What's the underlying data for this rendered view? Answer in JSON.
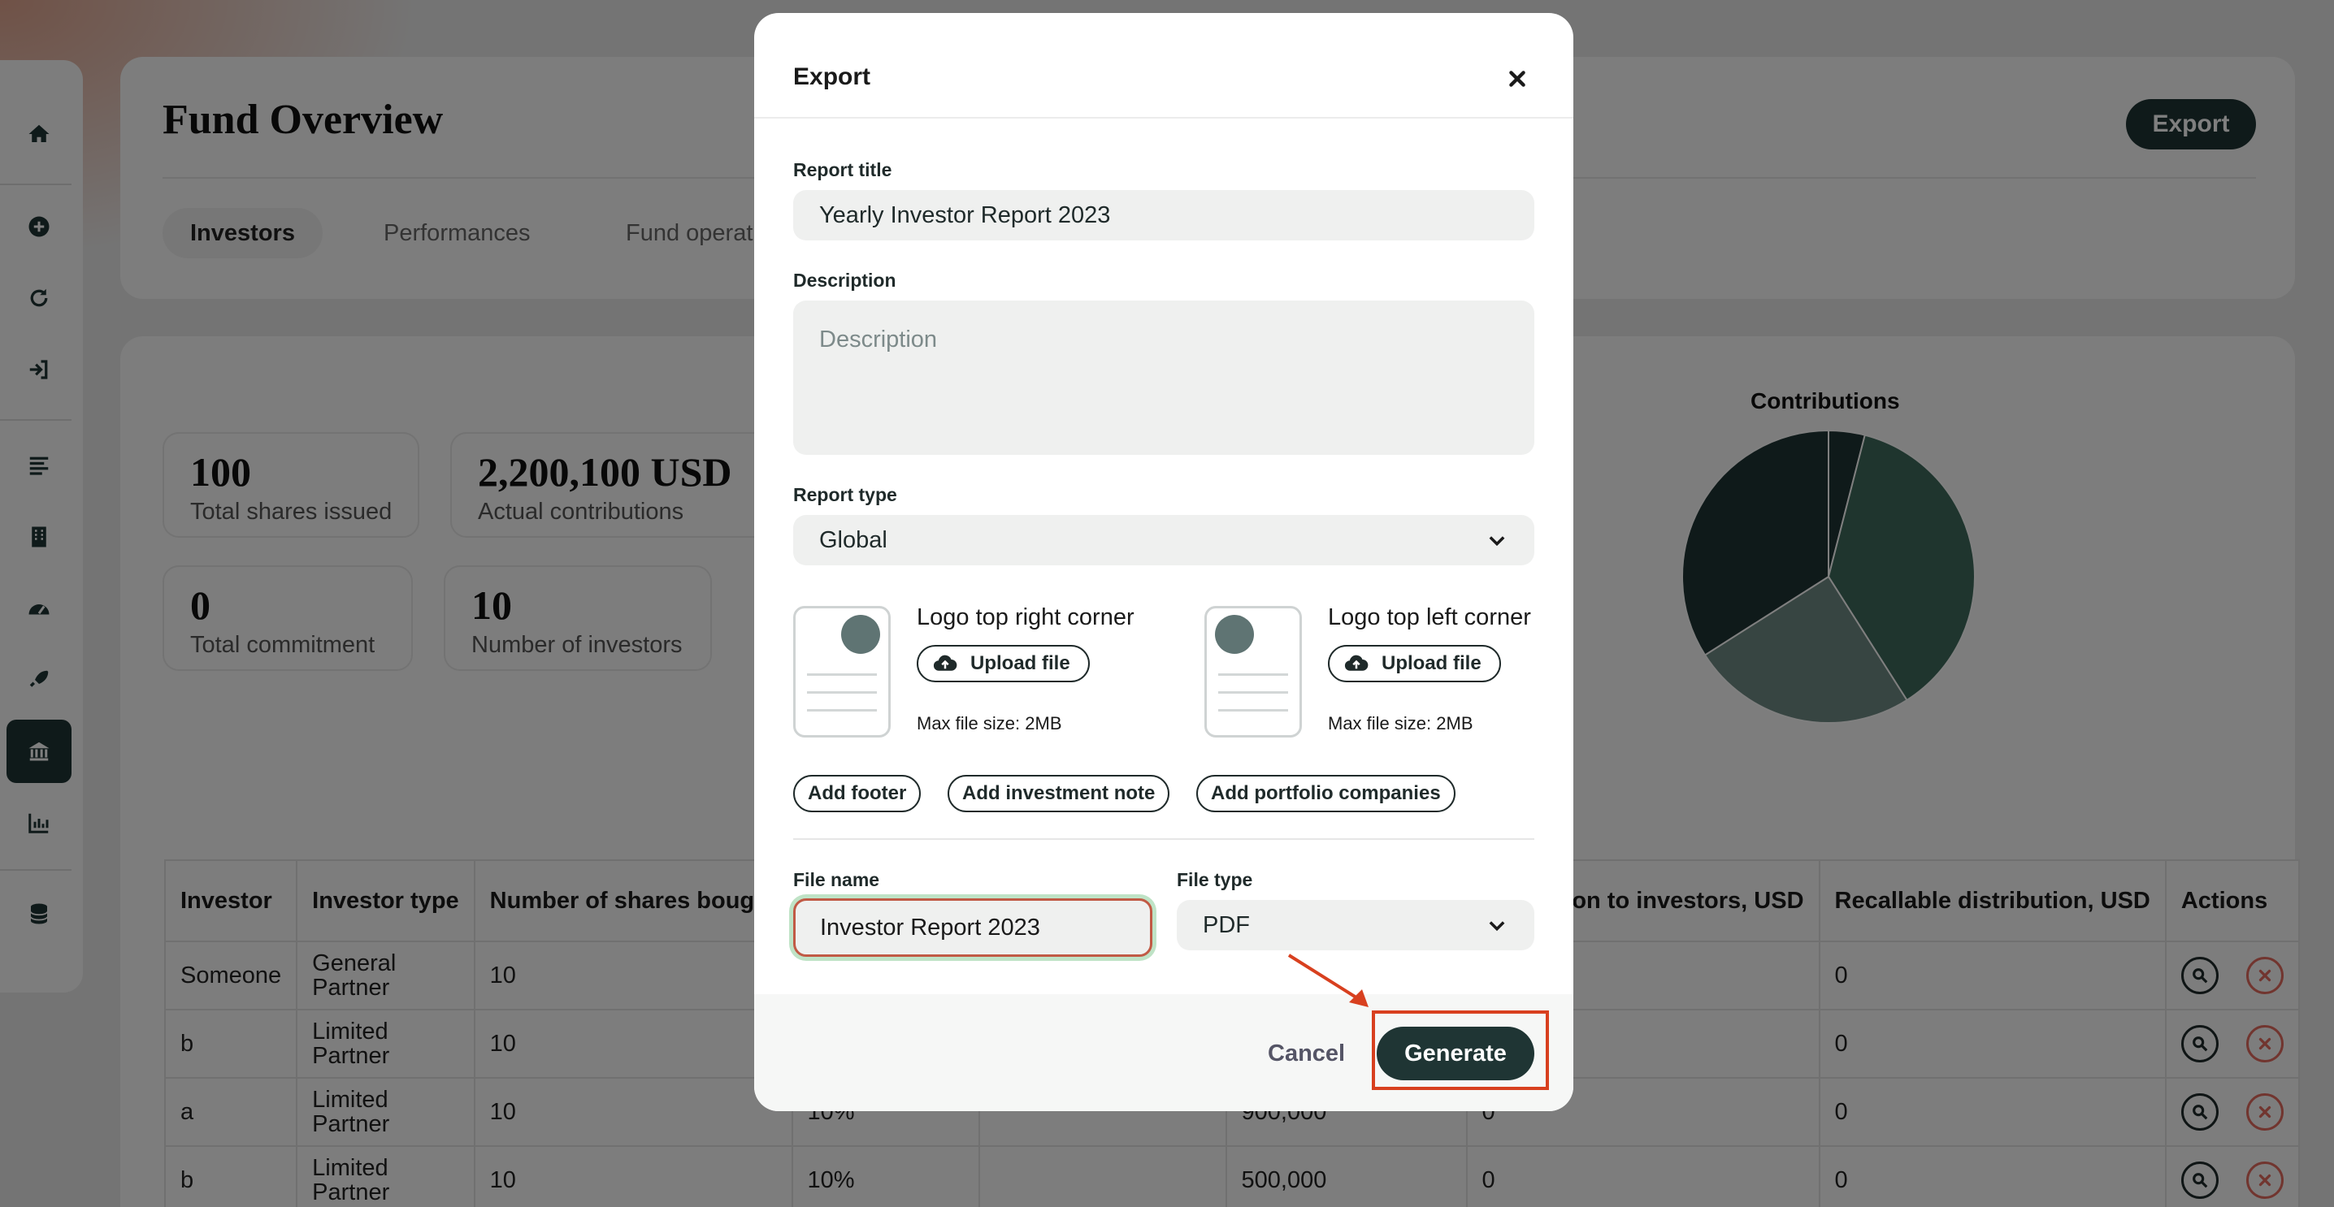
{
  "page": {
    "title": "Fund Overview",
    "export_label": "Export",
    "tabs": [
      "Investors",
      "Performances",
      "Fund operat"
    ]
  },
  "stats": [
    {
      "value": "100",
      "label": "Total shares issued"
    },
    {
      "value": "2,200,100 USD",
      "label": "Actual contributions"
    },
    {
      "value": "0",
      "label": "Total commitment"
    },
    {
      "value": "10",
      "label": "Number of investors"
    }
  ],
  "chart_data": {
    "type": "pie",
    "title": "Contributions",
    "values": [
      0.04,
      0.37,
      0.25,
      0.34
    ],
    "colors": [
      "#1f3534",
      "#3e6b5c",
      "#6f8a84",
      "#1f3534"
    ]
  },
  "table": {
    "headers": [
      "Investor",
      "Investor type",
      "Number of shares bought",
      "",
      "",
      "",
      "on to investors, USD",
      "Recallable distribution, USD",
      "Actions"
    ],
    "rows": [
      [
        "Someone",
        "General Partner",
        "10",
        "",
        "",
        "",
        "",
        "0"
      ],
      [
        "b",
        "Limited Partner",
        "10",
        "",
        "",
        "",
        "",
        "0"
      ],
      [
        "a",
        "Limited Partner",
        "10",
        "10%",
        "",
        "900,000",
        "0",
        "0"
      ],
      [
        "b",
        "Limited Partner",
        "10",
        "10%",
        "",
        "500,000",
        "0",
        "0"
      ]
    ]
  },
  "modal": {
    "title": "Export",
    "report_title_label": "Report title",
    "report_title_value": "Yearly Investor Report 2023",
    "description_label": "Description",
    "description_placeholder": "Description",
    "report_type_label": "Report type",
    "report_type_value": "Global",
    "logo_right": {
      "title": "Logo top right corner",
      "upload_label": "Upload file",
      "max_size": "Max file size: 2MB"
    },
    "logo_left": {
      "title": "Logo top left corner",
      "upload_label": "Upload file",
      "max_size": "Max file size: 2MB"
    },
    "chips": [
      "Add footer",
      "Add investment note",
      "Add portfolio companies"
    ],
    "file_name_label": "File name",
    "file_name_value": "Investor Report 2023",
    "file_type_label": "File type",
    "file_type_value": "PDF",
    "cancel_label": "Cancel",
    "generate_label": "Generate"
  },
  "colors": {
    "brand": "#1f3534",
    "highlight": "#d8401f",
    "delete": "#e36a5e"
  }
}
